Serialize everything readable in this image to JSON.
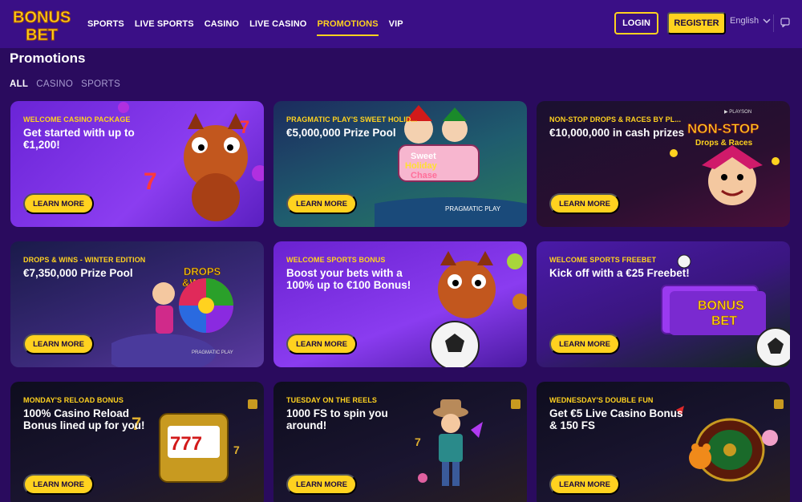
{
  "header": {
    "logo_text": "BONUS BET",
    "nav": [
      "SPORTS",
      "LIVE SPORTS",
      "CASINO",
      "LIVE CASINO",
      "PROMOTIONS",
      "VIP"
    ],
    "active_nav": "PROMOTIONS",
    "login_label": "LOGIN",
    "register_label": "REGISTER",
    "language": "English",
    "chat_icon": "chat-icon"
  },
  "page": {
    "title": "Promotions",
    "filters": [
      "ALL",
      "CASINO",
      "SPORTS"
    ],
    "active_filter": "ALL"
  },
  "cards": [
    {
      "eyebrow": "WELCOME CASINO PACKAGE",
      "headline": "Get started with up to €1,200!",
      "button": "LEARN MORE"
    },
    {
      "eyebrow": "PRAGMATIC PLAY'S SWEET HOLID...",
      "headline": "€5,000,000 Prize Pool",
      "button": "LEARN MORE",
      "art_text": "Sweet Holiday Chase",
      "badge": "PRAGMATIC PLAY"
    },
    {
      "eyebrow": "NON-STOP DROPS & RACES BY PL...",
      "headline": "€10,000,000 in cash prizes",
      "button": "LEARN MORE",
      "art_text": "NON-STOP Drops & Races",
      "badge": "PLAYSON"
    },
    {
      "eyebrow": "DROPS & WINS - WINTER EDITION",
      "headline": "€7,350,000 Prize Pool",
      "button": "LEARN MORE",
      "art_text": "DROPS & WINS",
      "badge": "PRAGMATIC PLAY"
    },
    {
      "eyebrow": "WELCOME SPORTS BONUS",
      "headline": "Boost your bets with a 100% up to €100 Bonus!",
      "button": "LEARN MORE"
    },
    {
      "eyebrow": "WELCOME SPORTS FREEBET",
      "headline": "Kick off with a €25 Freebet!",
      "button": "LEARN MORE",
      "art_text": "BONUS BET"
    },
    {
      "eyebrow": "MONDAY'S RELOAD BONUS",
      "headline": "100% Casino Reload Bonus lined up for you!",
      "button": "LEARN MORE",
      "art_text": "777"
    },
    {
      "eyebrow": "TUESDAY ON THE REELS",
      "headline": "1000 FS to spin you around!",
      "button": "LEARN MORE"
    },
    {
      "eyebrow": "WEDNESDAY'S DOUBLE FUN",
      "headline": "Get €5 Live Casino Bonus & 150 FS",
      "button": "LEARN MORE"
    }
  ],
  "colors": {
    "accent": "#ffd21f",
    "header_bg": "#3a0f86",
    "page_bg": "#2a0b5e"
  }
}
